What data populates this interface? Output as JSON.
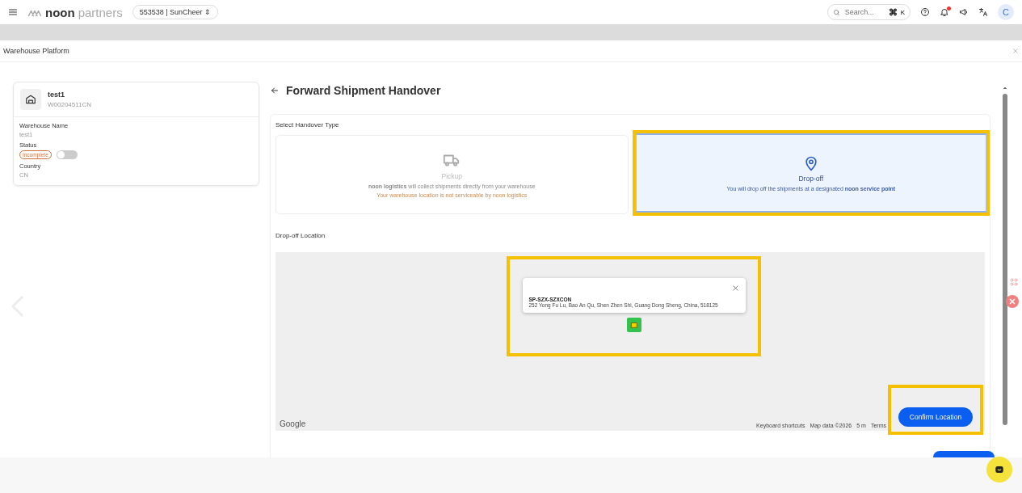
{
  "top_bar": {
    "brand": "noon",
    "brand_suffix": "partners",
    "account": "553538 | SunCheer",
    "account_caret": "⇕",
    "search_placeholder": "Search...",
    "shortcut": "⌘",
    "shortcut_key": "K",
    "avatar": "C",
    "has_notification": true
  },
  "modal": {
    "title": "Warehouse Platform"
  },
  "warehouse_card": {
    "name": "test1",
    "code": "W00204511CN",
    "fields": [
      {
        "kind": "text",
        "label": "Warehouse Name",
        "value": "test1"
      },
      {
        "kind": "status",
        "label": "Status",
        "badge": "Incomplete",
        "on": false
      },
      {
        "kind": "text",
        "label": "Country",
        "value": "CN"
      }
    ]
  },
  "page": {
    "heading": "Forward Shipment Handover",
    "section_label": "Select Handover Type",
    "handover_types": [
      {
        "kind": "pickup",
        "title": "Pickup",
        "description": "**noon logistics**  will collect shipments directly from your warehouse",
        "warning": "Your warehouse location is not serviceable by noon logistics",
        "selected": false
      },
      {
        "kind": "dropoff",
        "title": "Drop-off",
        "description": "You will drop off the shipments at a designated **noon service point**",
        "selected": true
      }
    ],
    "map": {
      "label": "Drop-off Location",
      "popup": {
        "code": "SP-SZX-SZXCON",
        "address": "252 Yong Fu Lu, Bao An Qu, Shen Zhen Shi, Guang Dong Sheng, China, 518125"
      },
      "attribution": "Google",
      "footer_links": [
        "Keyboard shortcuts",
        "Map data ©2026",
        "5 m",
        "Terms"
      ],
      "confirm": "Confirm Location"
    }
  }
}
